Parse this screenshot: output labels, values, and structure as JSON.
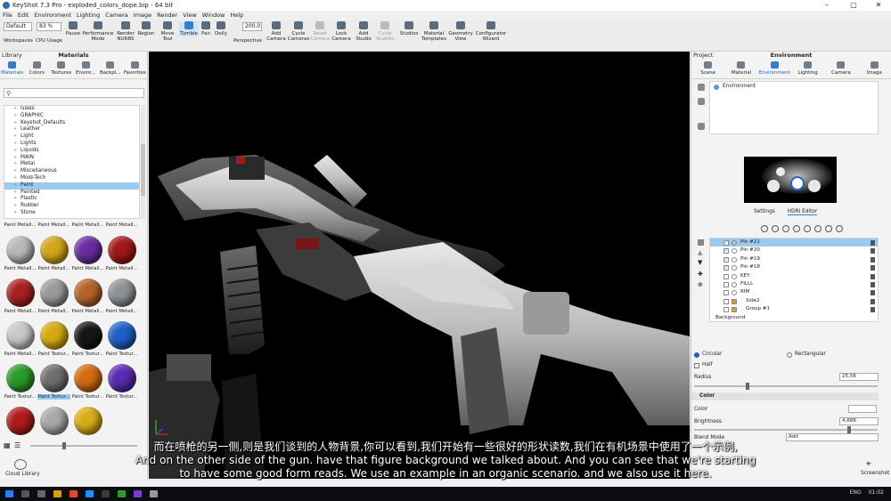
{
  "window": {
    "title": "KeyShot 7.3 Pro - exploded_colors_dope.bip - 64 bit"
  },
  "menu": [
    "File",
    "Edit",
    "Environment",
    "Lighting",
    "Camera",
    "Image",
    "Render",
    "View",
    "Window",
    "Help"
  ],
  "ribbon": {
    "workspace_value": "Default",
    "cpu_value": "83 %",
    "focal_value": "200,0",
    "labels": {
      "workspaces": "Workspaces",
      "cpu_usage": "CPU Usage",
      "pause": "Pause",
      "performance_mode": "Performance Mode",
      "render_nurbs": "Render NURBS",
      "region": "Region",
      "move_tool": "Move Tool",
      "tumble": "Tumble",
      "pan": "Pan",
      "dolly": "Dolly",
      "perspective": "Perspective",
      "add_camera": "Add Camera",
      "cycle_cameras": "Cycle Cameras",
      "reset_camera": "Reset Camera",
      "lock_camera": "Lock Camera",
      "add_studio": "Add Studio",
      "cycle_studios": "Cycle Studios",
      "studios": "Studios",
      "material_templates": "Material Templates",
      "geometry_view": "Geometry View",
      "configurator_wizard": "Configurator Wizard"
    }
  },
  "library": {
    "panel_label": "Library",
    "title": "Materials",
    "tabs": [
      "Materials",
      "Colors",
      "Textures",
      "Enviro...",
      "Backpl...",
      "Favorites"
    ],
    "tree": [
      "Glass",
      "GRAPHIC",
      "Keyshot_Defaults",
      "Leather",
      "Light",
      "Lights",
      "Liquids",
      "MAIN",
      "Metal",
      "Miscellaneous",
      "Mold-Tech",
      "Paint",
      "Painted",
      "Plastic",
      "Rubber",
      "Stone"
    ],
    "selected_folder": "Paint",
    "materials": [
      {
        "label": "Paint Metall...",
        "color": "#8a6a5a",
        "cut": true
      },
      {
        "label": "Paint Metall...",
        "color": "#9a8a80",
        "cut": true
      },
      {
        "label": "Paint Metall...",
        "color": "#a07050",
        "cut": true
      },
      {
        "label": "Paint Metall...",
        "color": "#9a5040",
        "cut": true
      },
      {
        "label": "Paint Metall...",
        "color": "#b8b8b8"
      },
      {
        "label": "Paint Metall...",
        "color": "#d4a51a"
      },
      {
        "label": "Paint Metall...",
        "color": "#6a2ca0"
      },
      {
        "label": "Paint Metall...",
        "color": "#a01818"
      },
      {
        "label": "Paint Metall...",
        "color": "#a82020"
      },
      {
        "label": "Paint Metall...",
        "color": "#9a9a9a"
      },
      {
        "label": "Paint Metall...",
        "color": "#b5632a"
      },
      {
        "label": "Paint Metall...",
        "color": "#8f9296"
      },
      {
        "label": "Paint Metall...",
        "color": "#c8c8c8"
      },
      {
        "label": "Paint Textur...",
        "color": "#d4aa12"
      },
      {
        "label": "Paint Textur...",
        "color": "#151515"
      },
      {
        "label": "Paint Textur...",
        "color": "#1e5fc8"
      },
      {
        "label": "Paint Textur...",
        "color": "#2a9a2a"
      },
      {
        "label": "Paint Textur...",
        "color": "#6e6e6e",
        "selected": true
      },
      {
        "label": "Paint Textur...",
        "color": "#d46a12"
      },
      {
        "label": "Paint Textur...",
        "color": "#5a2ab0"
      },
      {
        "label": "Paint Textur...",
        "color": "#b01a1a"
      },
      {
        "label": "Paint Textur...",
        "color": "#a9a9a9"
      },
      {
        "label": "Paint Textur...",
        "color": "#d8ae18"
      }
    ],
    "cloud_library": "Cloud Library"
  },
  "project": {
    "panel_label": "Project",
    "title": "Environment",
    "tabs": [
      "Scene",
      "Material",
      "Environment",
      "Lighting",
      "Camera",
      "Image"
    ],
    "environment_item": "Environment",
    "sub_tabs": [
      "Settings",
      "HDRI Editor"
    ],
    "pins": [
      {
        "label": "Pin #21",
        "checked": true,
        "selected": true
      },
      {
        "label": "Pin #20",
        "checked": true
      },
      {
        "label": "Pin #19",
        "checked": true
      },
      {
        "label": "Pin #18",
        "checked": true
      },
      {
        "label": "KEY",
        "checked": false
      },
      {
        "label": "FILLL",
        "checked": false
      },
      {
        "label": "RIM",
        "checked": false
      },
      {
        "label": "Side2",
        "checked": false,
        "group": true
      },
      {
        "label": "Group #1",
        "checked": false,
        "group": true
      }
    ],
    "background_item": "Background",
    "shape": {
      "circular": "Circular",
      "rectangular": "Rectangular",
      "half": "Half"
    },
    "radius_label": "Radius",
    "radius_value": "25,56",
    "color_section": "Color",
    "color_label": "Color",
    "brightness_label": "Brightness",
    "brightness_value": "4,686",
    "blend_mode_label": "Blend Mode",
    "blend_mode_value": "Add",
    "screenshot": "Screenshot"
  },
  "subtitles": {
    "chinese": "而在喷枪的另一侧,则是我们谈到的人物背景,你可以看到,我们开始有一些很好的形状读数,我们在有机场景中使用了一个示例,",
    "english_1": "And on the other side of the gun. have that figure background we talked about. And you can see that we're starting",
    "english_2": "to have some good form reads. We use an example in an organic scenario. and we also use it here."
  },
  "taskbar": {
    "lang": "ENG",
    "time": "01:02"
  }
}
